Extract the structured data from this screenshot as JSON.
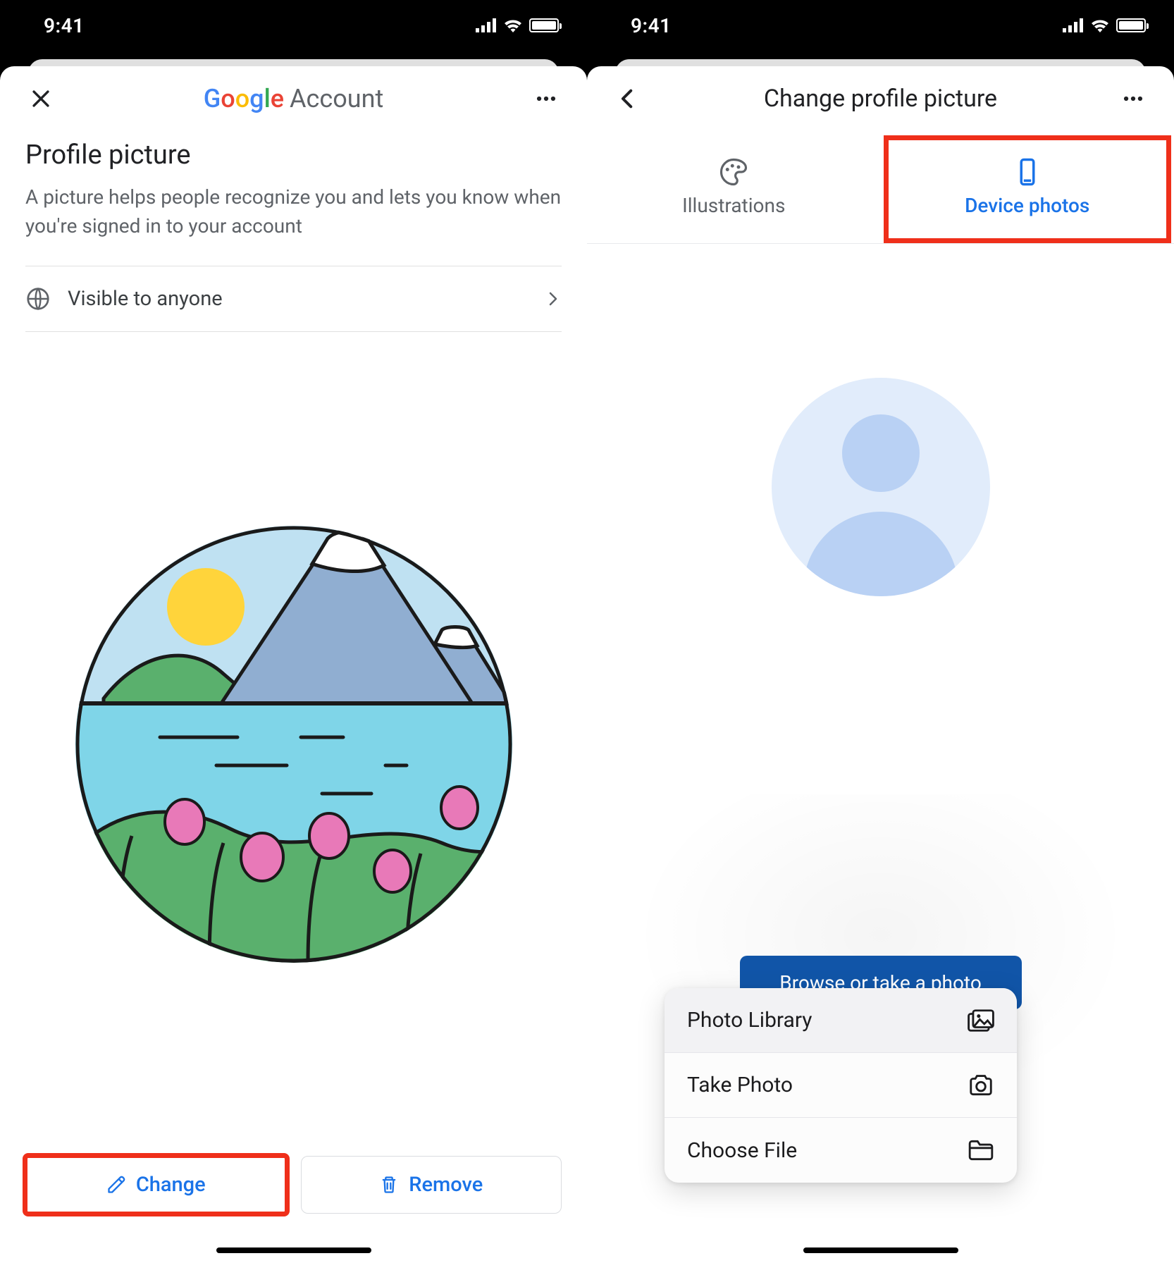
{
  "status": {
    "time": "9:41"
  },
  "colors": {
    "accent": "#1a73e8",
    "highlight": "#ef2f1a",
    "browse_btn": "#1155a8"
  },
  "left": {
    "header_brand_account": "Account",
    "section_title": "Profile picture",
    "section_desc": "A picture helps people recognize you and lets you know when you're signed in to your account",
    "visibility_label": "Visible to anyone",
    "buttons": {
      "change": "Change",
      "remove": "Remove"
    }
  },
  "right": {
    "header_title": "Change profile picture",
    "tabs": {
      "illustrations": "Illustrations",
      "device_photos": "Device photos"
    },
    "browse_label": "Browse or take a photo",
    "action_sheet": {
      "photo_library": "Photo Library",
      "take_photo": "Take Photo",
      "choose_file": "Choose File"
    }
  }
}
